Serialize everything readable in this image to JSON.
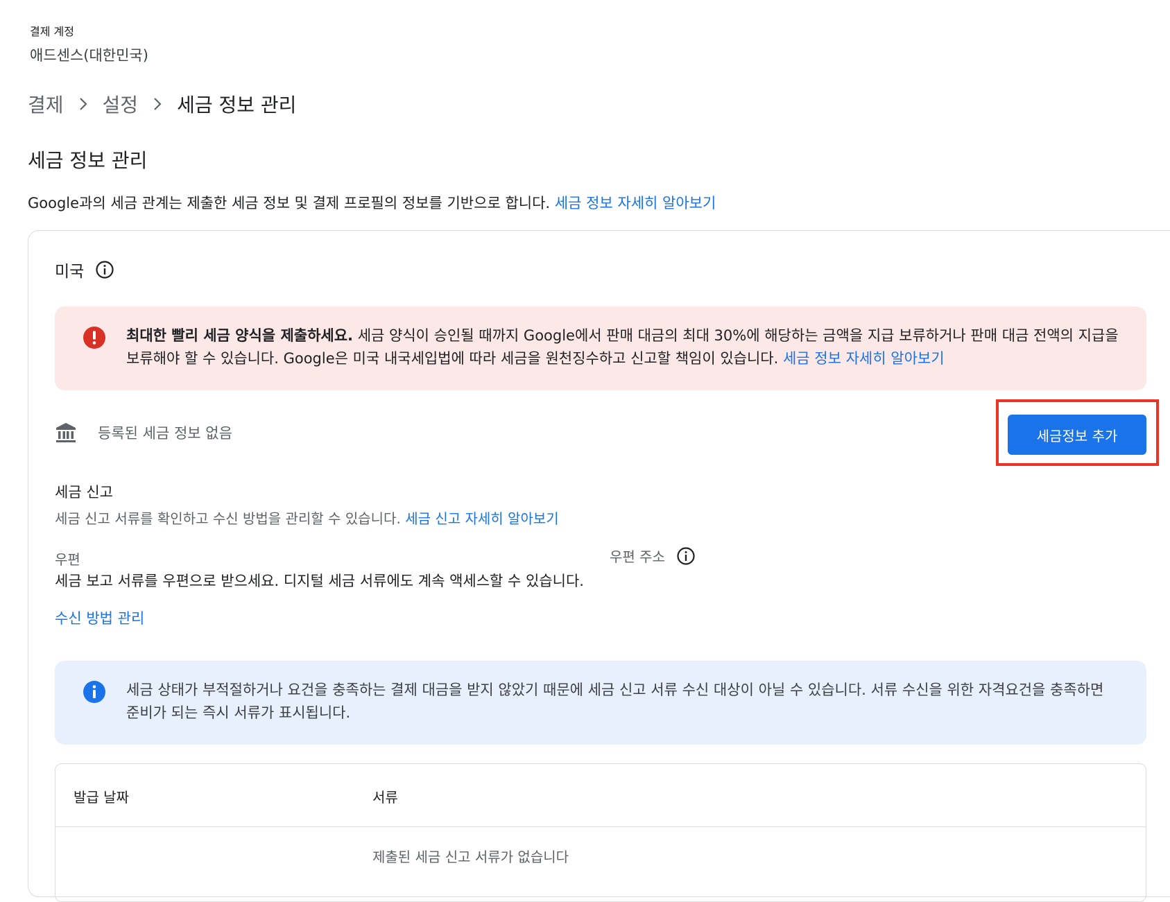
{
  "account": {
    "label": "결제 계정",
    "name": "애드센스(대한민국)"
  },
  "breadcrumb": {
    "items": [
      "결제",
      "설정"
    ],
    "current": "세금 정보 관리"
  },
  "page": {
    "title": "세금 정보 관리",
    "description": "Google과의 세금 관계는 제출한 세금 정보 및 결제 프로필의 정보를 기반으로 합니다. ",
    "learn_more": "세금 정보 자세히 알아보기"
  },
  "country": {
    "name": "미국"
  },
  "error_alert": {
    "bold": "최대한 빨리 세금 양식을 제출하세요.",
    "text": " 세금 양식이 승인될 때까지 Google에서 판매 대금의 최대 30%에 해당하는 금액을 지급 보류하거나 판매 대금 전액의 지급을 보류해야 할 수 있습니다. Google은 미국 내국세입법에 따라 세금을 원천징수하고 신고할 책임이 있습니다. ",
    "link": "세금 정보 자세히 알아보기"
  },
  "tax_info": {
    "status": "등록된 세금 정보 없음",
    "add_button": "세금정보 추가"
  },
  "tax_reporting": {
    "title": "세금 신고",
    "description": "세금 신고 서류를 확인하고 수신 방법을 관리할 수 있습니다. ",
    "learn_more": "세금 신고 자세히 알아보기",
    "mail_label": "우편",
    "mail_description": "세금 보고 서류를 우편으로 받으세요. 디지털 세금 서류에도 계속 액세스할 수 있습니다.",
    "address_label": "우편 주소",
    "manage_link": "수신 방법 관리"
  },
  "info_alert": {
    "text": "세금 상태가 부적절하거나 요건을 충족하는 결제 대금을 받지 않았기 때문에 세금 신고 서류 수신 대상이 아닐 수 있습니다. 서류 수신을 위한 자격요건을 충족하면 준비가 되는 즉시 서류가 표시됩니다."
  },
  "documents_table": {
    "headers": [
      "발급 날짜",
      "서류"
    ],
    "empty_text": "제출된 세금 신고 서류가 없습니다"
  },
  "colors": {
    "link": "#1a73e8",
    "primary_button": "#1a73e8",
    "error_bg": "#fce8e6",
    "error_icon": "#d93025",
    "info_bg": "#e8f0fe",
    "info_icon": "#1a73e8",
    "highlight": "#ea3323"
  },
  "icons": {
    "breadcrumb_separator": "chevron-right-icon",
    "country_info": "info-outline-icon",
    "error": "error-icon",
    "bank": "bank-icon",
    "address_info": "info-outline-icon",
    "info": "info-icon"
  }
}
